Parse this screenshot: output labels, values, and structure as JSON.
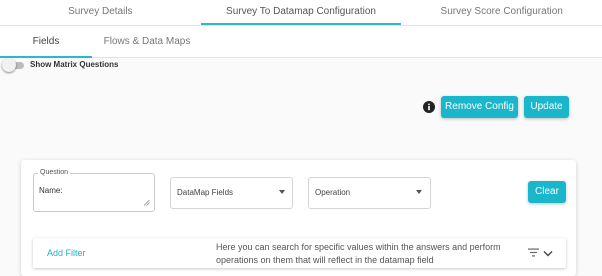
{
  "top_tabs": [
    {
      "label": "Survey Details"
    },
    {
      "label": "Survey To Datamap Configuration"
    },
    {
      "label": "Survey Score Configuration"
    }
  ],
  "sub_tabs": [
    {
      "label": "Fields"
    },
    {
      "label": "Flows & Data Maps"
    }
  ],
  "toggle": {
    "label": "Show Matrix Questions",
    "checked": false
  },
  "actions": {
    "info_icon": "info-icon",
    "remove_config": "Remove Config",
    "update": "Update"
  },
  "question": {
    "legend": "Question",
    "value": "Name:"
  },
  "datamap_select": {
    "label": "DataMap Fields"
  },
  "operation_select": {
    "label": "Operation"
  },
  "clear_button": "Clear",
  "filter": {
    "link": "Add Filter",
    "description": "Here you can search for specific values within the answers and perform operations on them that will reflect in the datamap field"
  },
  "colors": {
    "accent": "#1ab7cc",
    "tab_indicator": "#2bb8cc"
  }
}
